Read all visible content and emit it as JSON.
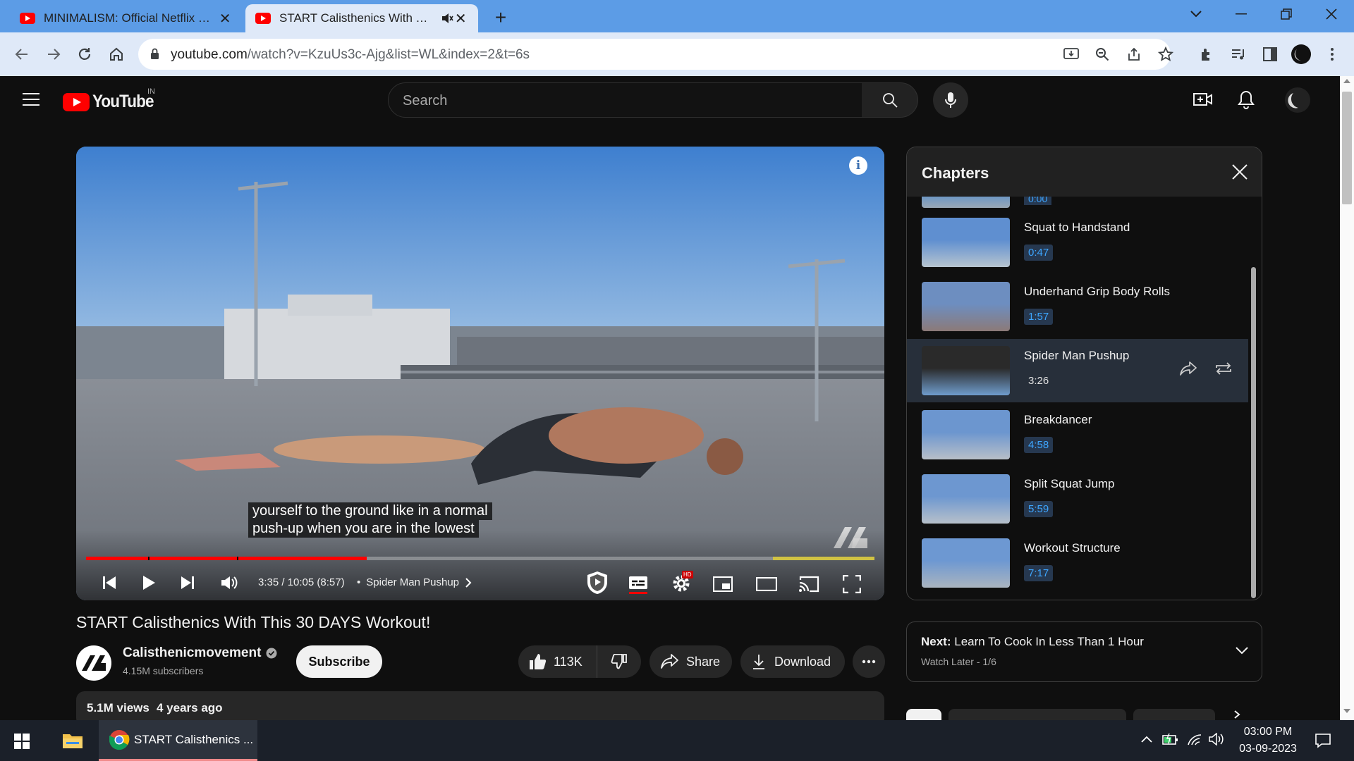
{
  "browser": {
    "tabs": [
      {
        "title": "MINIMALISM: Official Netflix Docu",
        "active": false
      },
      {
        "title": "START Calisthenics With This",
        "active": true
      }
    ],
    "address": {
      "host": "youtube.com",
      "path": "/watch?v=KzuUs3c-Ajg&list=WL&index=2&t=6s"
    }
  },
  "youtube": {
    "logo_text": "YouTube",
    "country": "IN",
    "search_placeholder": "Search"
  },
  "player": {
    "captions": [
      "yourself to the ground like in a normal",
      "push-up when you are in the lowest"
    ],
    "time": "3:35 / 10:05 (8:57)",
    "chapter": "Spider Man Pushup",
    "progress": 0.356,
    "hd_badge": "HD"
  },
  "video": {
    "title": "START Calisthenics With This 30 DAYS Workout!",
    "channel": "Calisthenicmovement",
    "subscribers": "4.15M subscribers",
    "subscribe_label": "Subscribe",
    "likes": "113K",
    "share_label": "Share",
    "download_label": "Download",
    "views": "5.1M views",
    "age": "4 years ago"
  },
  "chapters": {
    "title": "Chapters",
    "partial_time": "0:00",
    "items": [
      {
        "name": "Squat to Handstand",
        "time": "0:47"
      },
      {
        "name": "Underhand Grip Body Rolls",
        "time": "1:57"
      },
      {
        "name": "Spider Man Pushup",
        "time": "3:26",
        "active": true
      },
      {
        "name": "Breakdancer",
        "time": "4:58"
      },
      {
        "name": "Split Squat Jump",
        "time": "5:59"
      },
      {
        "name": "Workout Structure",
        "time": "7:17"
      }
    ]
  },
  "next": {
    "label": "Next:",
    "title": "Learn To Cook In Less Than 1 Hour",
    "playlist": "Watch Later - 1/6"
  },
  "taskbar": {
    "app_label": "START Calisthenics ...",
    "time": "03:00 PM",
    "date": "03-09-2023"
  }
}
